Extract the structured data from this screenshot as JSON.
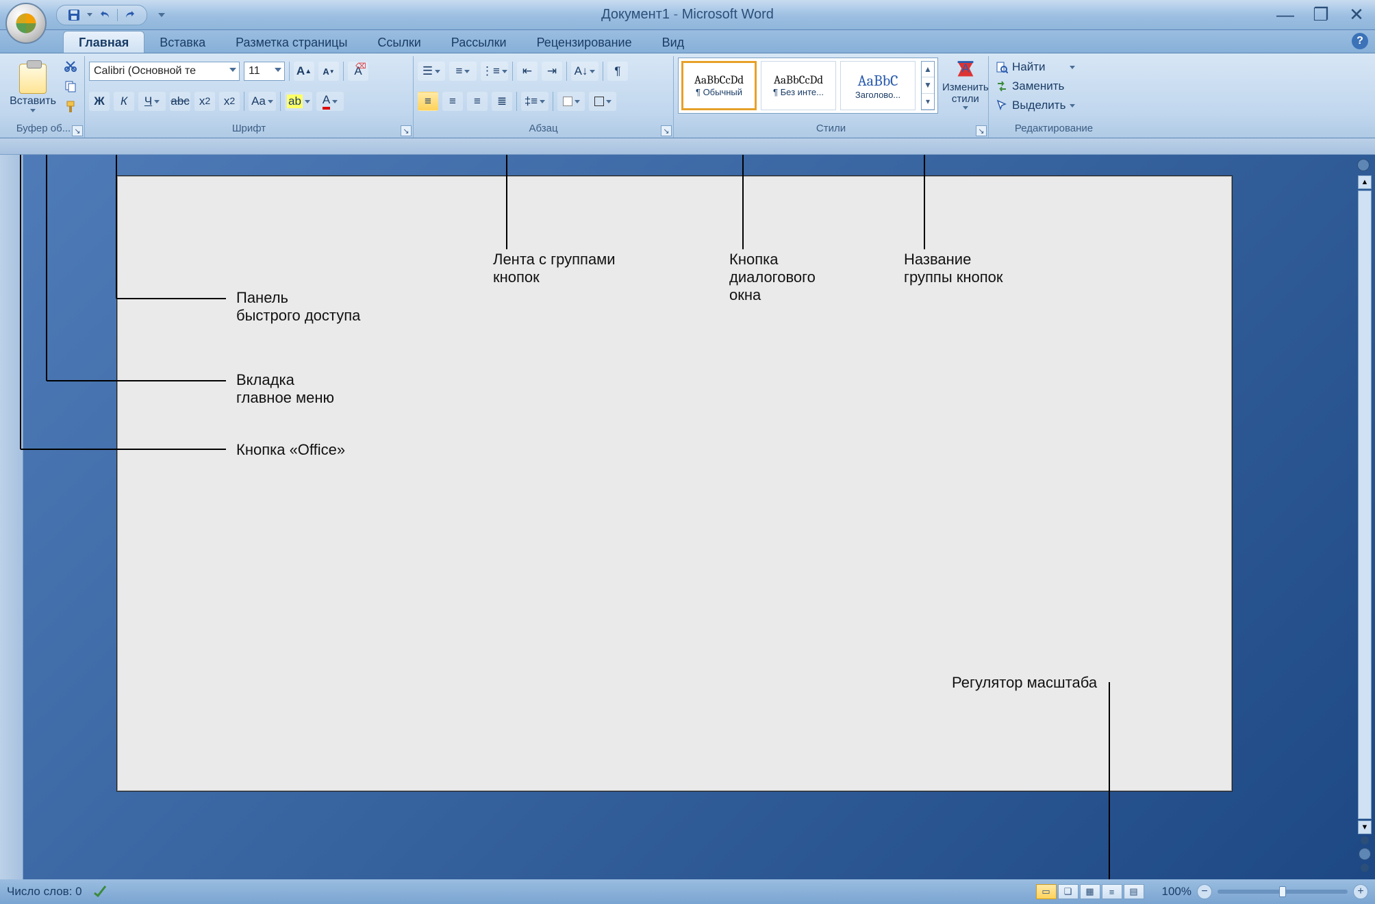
{
  "title": {
    "doc": "Документ1",
    "app": "Microsoft Word"
  },
  "tabs": [
    "Главная",
    "Вставка",
    "Разметка страницы",
    "Ссылки",
    "Рассылки",
    "Рецензирование",
    "Вид"
  ],
  "clipboard": {
    "paste": "Вставить",
    "group": "Буфер об..."
  },
  "font": {
    "family": "Calibri (Основной те",
    "size": "11",
    "group": "Шрифт",
    "btns": {
      "bold": "Ж",
      "italic": "К",
      "underline": "Ч",
      "strike": "abc",
      "sub": "x₂",
      "sup": "x²",
      "case": "Aa",
      "grow": "A",
      "shrink": "A",
      "clear": "Aa",
      "highlight": "ab",
      "color": "A"
    }
  },
  "para": {
    "group": "Абзац"
  },
  "styles": {
    "group": "Стили",
    "items": [
      {
        "preview": "AaBbCcDd",
        "name": "¶ Обычный"
      },
      {
        "preview": "AaBbCcDd",
        "name": "¶ Без инте..."
      },
      {
        "preview": "AaBbC",
        "name": "Заголово..."
      }
    ],
    "change": "Изменить стили"
  },
  "editing": {
    "group": "Редактирование",
    "find": "Найти",
    "replace": "Заменить",
    "select": "Выделить"
  },
  "status": {
    "words": "Число слов: 0",
    "zoom": "100%"
  },
  "callouts": {
    "qat": "Панель\nбыстрого доступа",
    "tab": "Вкладка\nглавное меню",
    "office": "Кнопка «Office»",
    "ribbon": "Лента с группами\nкнопок",
    "dlg": "Кнопка\nдиалогового\nокна",
    "groupname": "Название\nгруппы кнопок",
    "zoom": "Регулятор масштаба"
  }
}
